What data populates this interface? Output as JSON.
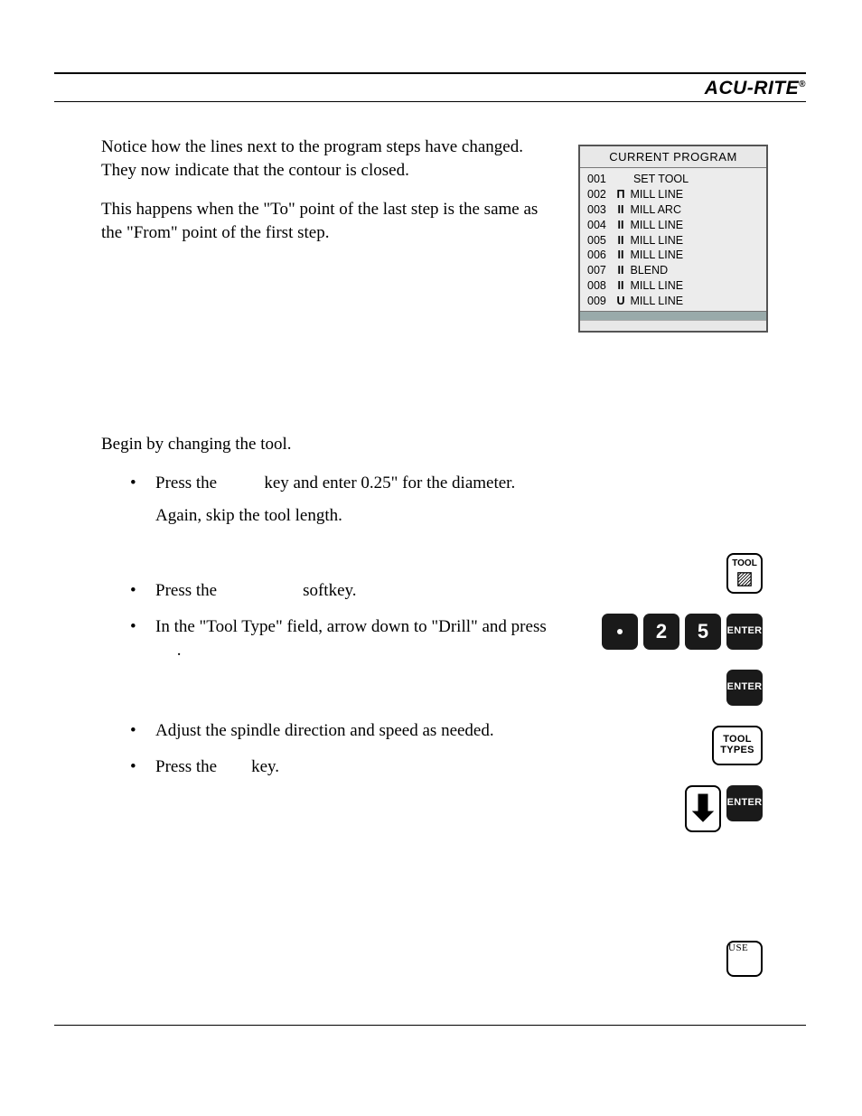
{
  "brand": {
    "name": "ACU-RITE",
    "mark": "®"
  },
  "intro": {
    "p1": "Notice how the lines next to the program steps have changed. They now indicate that the contour is closed.",
    "p2": "This happens when the \"To\" point of the last step is the same as the \"From\" point of the first step."
  },
  "panel": {
    "title": "CURRENT PROGRAM",
    "rows": [
      {
        "num": "001",
        "sym": "",
        "label": "SET TOOL"
      },
      {
        "num": "002",
        "sym": "Π",
        "label": "MILL LINE"
      },
      {
        "num": "003",
        "sym": "II",
        "label": "MILL ARC"
      },
      {
        "num": "004",
        "sym": "II",
        "label": "MILL LINE"
      },
      {
        "num": "005",
        "sym": "II",
        "label": "MILL LINE"
      },
      {
        "num": "006",
        "sym": "II",
        "label": "MILL LINE"
      },
      {
        "num": "007",
        "sym": "II",
        "label": "BLEND"
      },
      {
        "num": "008",
        "sym": "II",
        "label": "MILL LINE"
      },
      {
        "num": "009",
        "sym": "U",
        "label": "MILL LINE"
      }
    ]
  },
  "steps": {
    "lead": "Begin by changing the tool.",
    "b1a": "Press the",
    "b1b": "key and enter 0.25\" for the diameter.",
    "b1c": "Again, skip the tool length.",
    "b2a": "Press the",
    "b2b": "softkey.",
    "b3": "In the \"Tool Type\" field, arrow down to \"Drill\" and press",
    "b3dot": ".",
    "b4": "Adjust the spindle direction and speed as needed.",
    "b5a": "Press the",
    "b5b": "key."
  },
  "keys": {
    "tool": "TOOL",
    "dot": ".",
    "two": "2",
    "five": "5",
    "enter": "ENTER",
    "tool_types_1": "TOOL",
    "tool_types_2": "TYPES",
    "use": "USE"
  }
}
